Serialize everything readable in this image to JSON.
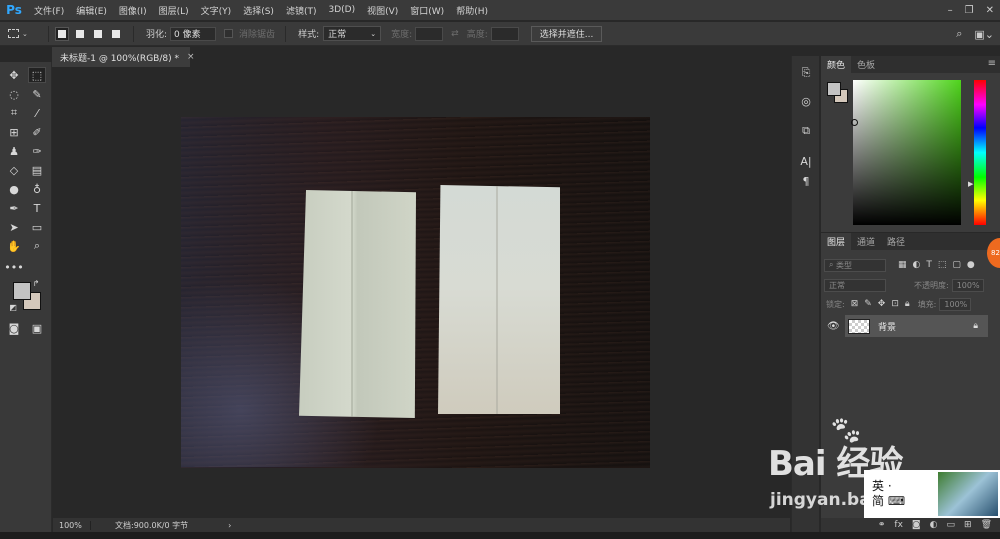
{
  "app": {
    "logo": "Ps"
  },
  "menu": [
    "文件(F)",
    "编辑(E)",
    "图像(I)",
    "图层(L)",
    "文字(Y)",
    "选择(S)",
    "滤镜(T)",
    "3D(D)",
    "视图(V)",
    "窗口(W)",
    "帮助(H)"
  ],
  "options": {
    "feather_label": "羽化:",
    "feather_value": "0 像素",
    "antialias_label": "消除锯齿",
    "style_label": "样式:",
    "style_value": "正常",
    "width_label": "宽度:",
    "height_label": "高度:",
    "select_mask_button": "选择并遮住..."
  },
  "document": {
    "tab_title": "未标题-1 @ 100%(RGB/8) *",
    "tab_close": "×"
  },
  "status": {
    "zoom": "100%",
    "doc_info": "文档:900.0K/0 字节",
    "arrow": "›"
  },
  "color_panel": {
    "tabs": [
      "颜色",
      "色板"
    ],
    "fg_color": "#c3c3c3",
    "bg_color": "#d4c8bb",
    "hue_color": "#4fd41c"
  },
  "layers_panel": {
    "tabs": [
      "图层",
      "通道",
      "路径"
    ],
    "filter_label": "类型",
    "blend_mode": "正常",
    "opacity_label": "不透明度:",
    "opacity_value": "100%",
    "lock_label": "锁定:",
    "fill_label": "填充:",
    "fill_value": "100%",
    "layers": [
      {
        "name": "背景",
        "locked": true,
        "visible": true
      }
    ]
  },
  "badge": {
    "text": "82"
  },
  "watermark": {
    "logo": "Bai  经验",
    "url": "jingyan.baidu.com"
  },
  "ime": {
    "line1": "英 ·",
    "line2": "简 ⌨"
  }
}
